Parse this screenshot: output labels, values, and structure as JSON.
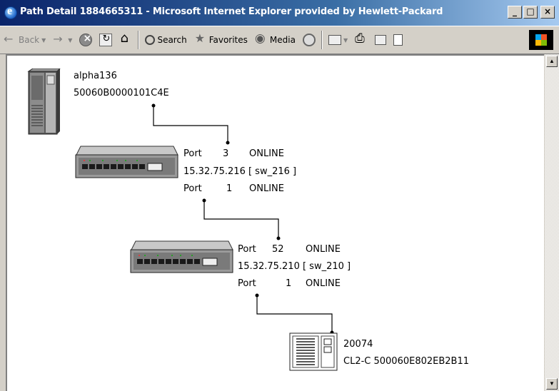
{
  "window": {
    "title": "Path Detail 1884665311 - Microsoft Internet Explorer provided by Hewlett-Packard",
    "minimize": "_",
    "maximize": "□",
    "close": "×"
  },
  "toolbar": {
    "back": "Back",
    "search": "Search",
    "favorites": "Favorites",
    "media": "Media"
  },
  "nodes": {
    "host": {
      "name": "alpha136",
      "wwn": "50060B0000101C4E"
    },
    "switch1": {
      "port_in_label": "Port",
      "port_in": "3",
      "port_in_status": "ONLINE",
      "address": "15.32.75.216 [ sw_216 ]",
      "port_out_label": "Port",
      "port_out": "1",
      "port_out_status": "ONLINE"
    },
    "switch2": {
      "port_in_label": "Port",
      "port_in": "52",
      "port_in_status": "ONLINE",
      "address": "15.32.75.210 [ sw_210 ]",
      "port_out_label": "Port",
      "port_out": "1",
      "port_out_status": "ONLINE"
    },
    "storage": {
      "name": "20074",
      "wwn": "CL2-C 500060E802EB2B11"
    }
  }
}
